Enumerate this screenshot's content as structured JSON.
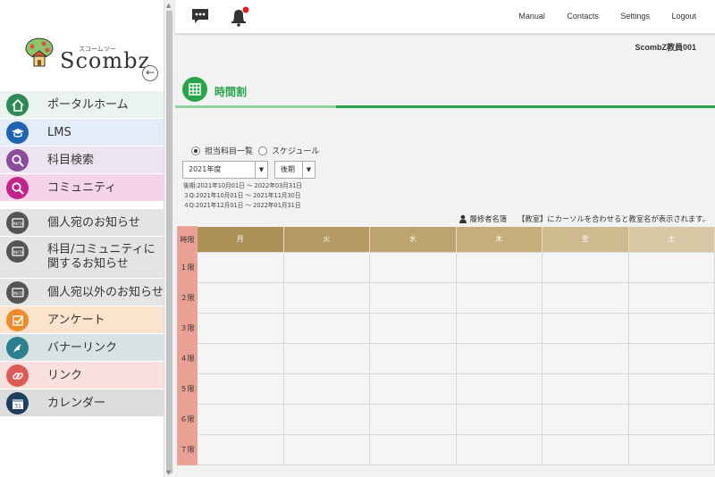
{
  "logo": {
    "kana": "スコームツー",
    "text": "Scombz"
  },
  "sidebar": {
    "items": [
      {
        "label": "ポータルホーム",
        "icon": "home-icon",
        "bg": "#eaf3ee",
        "iconColor": "#2e8b57"
      },
      {
        "label": "LMS",
        "icon": "graduation-cap-icon",
        "bg": "#e4edf7",
        "iconColor": "#1f64b0"
      },
      {
        "label": "科目検索",
        "icon": "search-icon",
        "bg": "#ece4ef",
        "iconColor": "#8a4d9c"
      },
      {
        "label": "コミュニティ",
        "icon": "community-search-icon",
        "bg": "#f5d4ea",
        "iconColor": "#c3238a"
      },
      {
        "label": "個人宛のお知らせ",
        "icon": "info-icon",
        "bg": "#e4e4e4",
        "iconColor": "#555555"
      },
      {
        "label": "科目/コミュニティに\n関するお知らせ",
        "icon": "info-icon",
        "bg": "#e4e4e4",
        "iconColor": "#555555"
      },
      {
        "label": "個人宛以外のお知らせ",
        "icon": "info-icon",
        "bg": "#e4e4e4",
        "iconColor": "#555555"
      },
      {
        "label": "アンケート",
        "icon": "checkbox-icon",
        "bg": "#fce3cd",
        "iconColor": "#ee8b2a"
      },
      {
        "label": "バナーリンク",
        "icon": "bird-icon",
        "bg": "#d6e2e4",
        "iconColor": "#2c7f8c"
      },
      {
        "label": "リンク",
        "icon": "link-icon",
        "bg": "#f8e0df",
        "iconColor": "#dc5b56"
      },
      {
        "label": "カレンダー",
        "icon": "calendar-icon",
        "bg": "#dddddd",
        "iconColor": "#1f3f5e"
      }
    ]
  },
  "topbar": {
    "links": [
      "Manual",
      "Contacts",
      "Settings",
      "Logout"
    ],
    "user": "ScombZ教員001"
  },
  "page": {
    "title": "時間割"
  },
  "controls": {
    "radio1": "担当科目一覧",
    "radio2": "スケジュール",
    "year": "2021年度",
    "term": "後期",
    "dates": [
      "後期:2021年10月01日 〜 2022年03月31日",
      "３Q:2021年10月01日 〜 2021年11月30日",
      "４Q:2021年12月01日 〜 2022年01月31日"
    ],
    "roster": "履修者名簿",
    "hint": "【教室】にカーソルを合わせると教室名が表示されます。"
  },
  "timetable": {
    "corner": "時限",
    "days": [
      "月",
      "火",
      "水",
      "木",
      "金",
      "土"
    ],
    "periods": [
      "１限",
      "２限",
      "３限",
      "４限",
      "５限",
      "６限",
      "７限"
    ]
  },
  "colors": {
    "accent": "#2aa44a",
    "periodCol": "#eaa093"
  }
}
